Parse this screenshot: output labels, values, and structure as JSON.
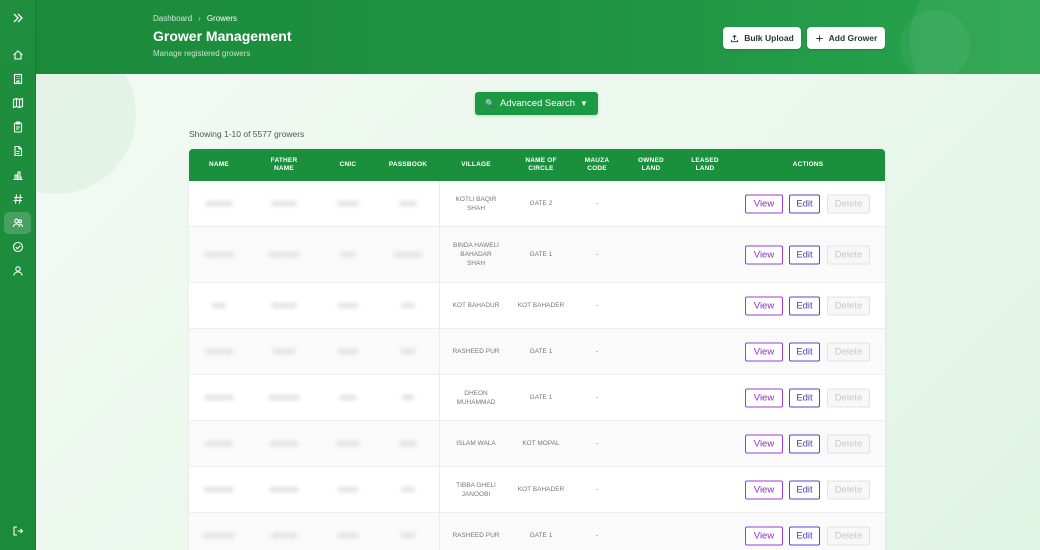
{
  "breadcrumb": {
    "home": "Dashboard",
    "separator": "›",
    "current": "Growers"
  },
  "page": {
    "title": "Grower Management",
    "subtitle": "Manage registered growers"
  },
  "header_buttons": {
    "bulk_upload": "Bulk Upload",
    "add_grower": "Add Grower"
  },
  "search": {
    "advanced_label": "Advanced Search",
    "advanced_caret": "▼",
    "icon": "search-icon"
  },
  "summary": {
    "showing": "Showing 1-10 of 5577 growers"
  },
  "table": {
    "columns": [
      {
        "label": "NAME"
      },
      {
        "label": "FATHER NAME"
      },
      {
        "label": "CNIC"
      },
      {
        "label": "PASSBOOK"
      },
      {
        "label": "VILLAGE"
      },
      {
        "label": "NAME OF CIRCLE"
      },
      {
        "label": "MAUZA CODE"
      },
      {
        "label": "OWNED LAND"
      },
      {
        "label": "LEASED LAND"
      },
      {
        "label": "ACTIONS"
      }
    ],
    "rows": [
      {
        "village": "KOTLI BAQIR SHAH",
        "circle": "GATE 2",
        "mauza": "-",
        "owned": "",
        "leased": ""
      },
      {
        "village": "BINDA HAWELI BAHADAR SHAH",
        "circle": "GATE 1",
        "mauza": "-",
        "owned": "",
        "leased": ""
      },
      {
        "village": "KOT BAHADUR",
        "circle": "KOT BAHADER",
        "mauza": "-",
        "owned": "",
        "leased": ""
      },
      {
        "village": "RASHEED PUR",
        "circle": "GATE 1",
        "mauza": "-",
        "owned": "",
        "leased": ""
      },
      {
        "village": "DHEON MUHAMMAD",
        "circle": "GATE 1",
        "mauza": "-",
        "owned": "",
        "leased": ""
      },
      {
        "village": "ISLAM WALA",
        "circle": "KOT MOPAL",
        "mauza": "-",
        "owned": "",
        "leased": ""
      },
      {
        "village": "TIBBA GHELI JANOOBI",
        "circle": "KOT BAHADER",
        "mauza": "-",
        "owned": "",
        "leased": ""
      },
      {
        "village": "RASHEED PUR",
        "circle": "GATE 1",
        "mauza": "-",
        "owned": "",
        "leased": ""
      }
    ],
    "actions": {
      "view": "View",
      "edit": "Edit",
      "delete": "Delete"
    }
  },
  "sidebar": {
    "items": [
      {
        "icon": "home-icon"
      },
      {
        "icon": "building-icon"
      },
      {
        "icon": "map-icon"
      },
      {
        "icon": "clipboard-icon"
      },
      {
        "icon": "document-icon"
      },
      {
        "icon": "chart-icon"
      },
      {
        "icon": "hash-icon"
      },
      {
        "icon": "users-icon"
      },
      {
        "icon": "check-circle-icon"
      },
      {
        "icon": "user-icon"
      }
    ],
    "active_index": 7
  },
  "colors": {
    "primary": "#1a8f3c",
    "view": "#8a2fc4",
    "edit": "#4a3ab5",
    "delete_disabled": "#c8c8c8"
  }
}
